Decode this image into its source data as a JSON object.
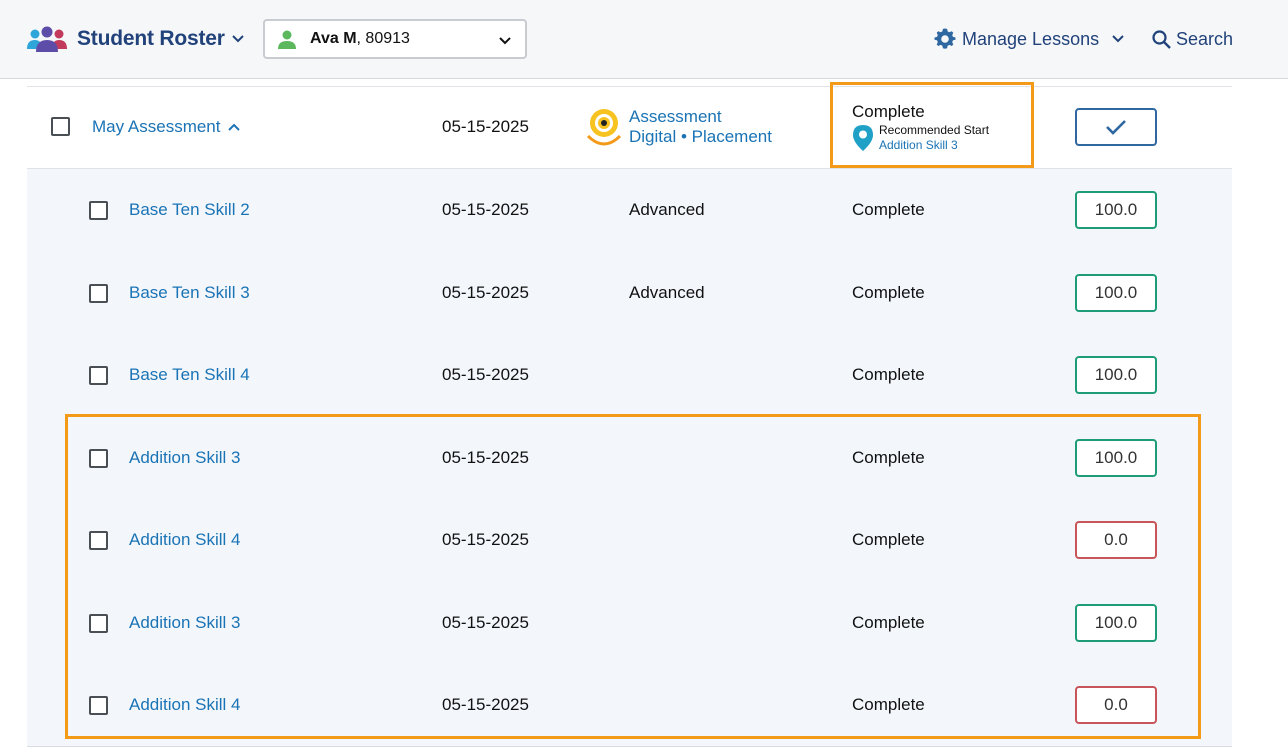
{
  "header": {
    "title": "Student Roster",
    "student": {
      "name": "Ava M",
      "id_suffix": ", 80913"
    },
    "manage_label": "Manage Lessons",
    "search_label": "Search"
  },
  "assessment": {
    "title": "May Assessment",
    "date": "05-15-2025",
    "type_line1": "Assessment",
    "type_line2": "Digital • Placement",
    "status": "Complete",
    "recommended_label": "Recommended Start",
    "recommended_link": "Addition Skill 3"
  },
  "rows": [
    {
      "name": "Base Ten Skill 2",
      "date": "05-15-2025",
      "level": "Advanced",
      "status": "Complete",
      "score": "100.0",
      "pass": true
    },
    {
      "name": "Base Ten Skill 3",
      "date": "05-15-2025",
      "level": "Advanced",
      "status": "Complete",
      "score": "100.0",
      "pass": true
    },
    {
      "name": "Base Ten Skill 4",
      "date": "05-15-2025",
      "level": "",
      "status": "Complete",
      "score": "100.0",
      "pass": true
    },
    {
      "name": "Addition Skill 3",
      "date": "05-15-2025",
      "level": "",
      "status": "Complete",
      "score": "100.0",
      "pass": true
    },
    {
      "name": "Addition Skill 4",
      "date": "05-15-2025",
      "level": "",
      "status": "Complete",
      "score": "0.0",
      "pass": false
    },
    {
      "name": "Addition Skill 3",
      "date": "05-15-2025",
      "level": "",
      "status": "Complete",
      "score": "100.0",
      "pass": true
    },
    {
      "name": "Addition Skill 4",
      "date": "05-15-2025",
      "level": "",
      "status": "Complete",
      "score": "0.0",
      "pass": false
    }
  ],
  "colors": {
    "brand": "#21427a",
    "link": "#1a73b5",
    "highlight": "#f39a19",
    "pass": "#1d9c77",
    "fail": "#c8555a"
  },
  "icons": {
    "brand": "people-group-icon",
    "student": "person-icon",
    "manage": "gear-icon",
    "search": "search-icon",
    "assessment": "target-icon",
    "recommended": "map-pin-icon"
  }
}
